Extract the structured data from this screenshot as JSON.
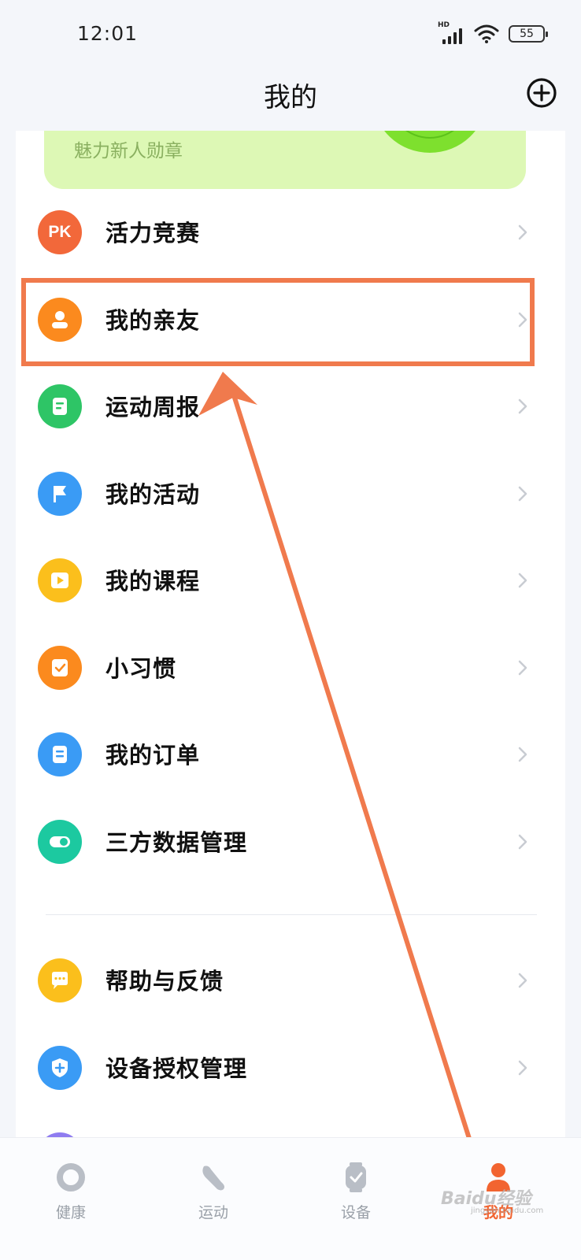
{
  "status_bar": {
    "time": "12:01",
    "signal_label": "HD",
    "battery": "55"
  },
  "header": {
    "title": "我的",
    "add_icon": "plus-circle-icon"
  },
  "medal_card": {
    "text": "魅力新人勋章",
    "accent": "#ddf8b5"
  },
  "menu": {
    "items": [
      {
        "label": "活力竞赛",
        "icon": "pk-icon",
        "icon_text": "PK",
        "color": "#f2683a"
      },
      {
        "label": "我的亲友",
        "icon": "person-icon",
        "color": "#fb8a1e"
      },
      {
        "label": "运动周报",
        "icon": "report-icon",
        "color": "#2ec566"
      },
      {
        "label": "我的活动",
        "icon": "flag-icon",
        "color": "#3a9bf5"
      },
      {
        "label": "我的课程",
        "icon": "play-icon",
        "color": "#fbbf1c"
      },
      {
        "label": "小习惯",
        "icon": "habit-icon",
        "color": "#fb8a1e"
      },
      {
        "label": "我的订单",
        "icon": "order-icon",
        "color": "#3a9bf5"
      },
      {
        "label": "三方数据管理",
        "icon": "toggle-icon",
        "color": "#1cc9a0"
      },
      {
        "label": "帮助与反馈",
        "icon": "chat-icon",
        "color": "#fbbf1c"
      },
      {
        "label": "设备授权管理",
        "icon": "shield-icon",
        "color": "#3a9bf5"
      }
    ]
  },
  "annotation": {
    "highlight_color": "#f07a4d",
    "target": "我的亲友"
  },
  "tab_bar": {
    "tabs": [
      {
        "label": "健康",
        "icon": "ring-icon",
        "active": false
      },
      {
        "label": "运动",
        "icon": "shoe-icon",
        "active": false
      },
      {
        "label": "设备",
        "icon": "watch-icon",
        "active": false
      },
      {
        "label": "我的",
        "icon": "user-icon",
        "active": true
      }
    ],
    "active_color": "#f26430"
  },
  "watermark": {
    "text": "Baidu经验",
    "sub": "jingyan.baidu.com"
  }
}
